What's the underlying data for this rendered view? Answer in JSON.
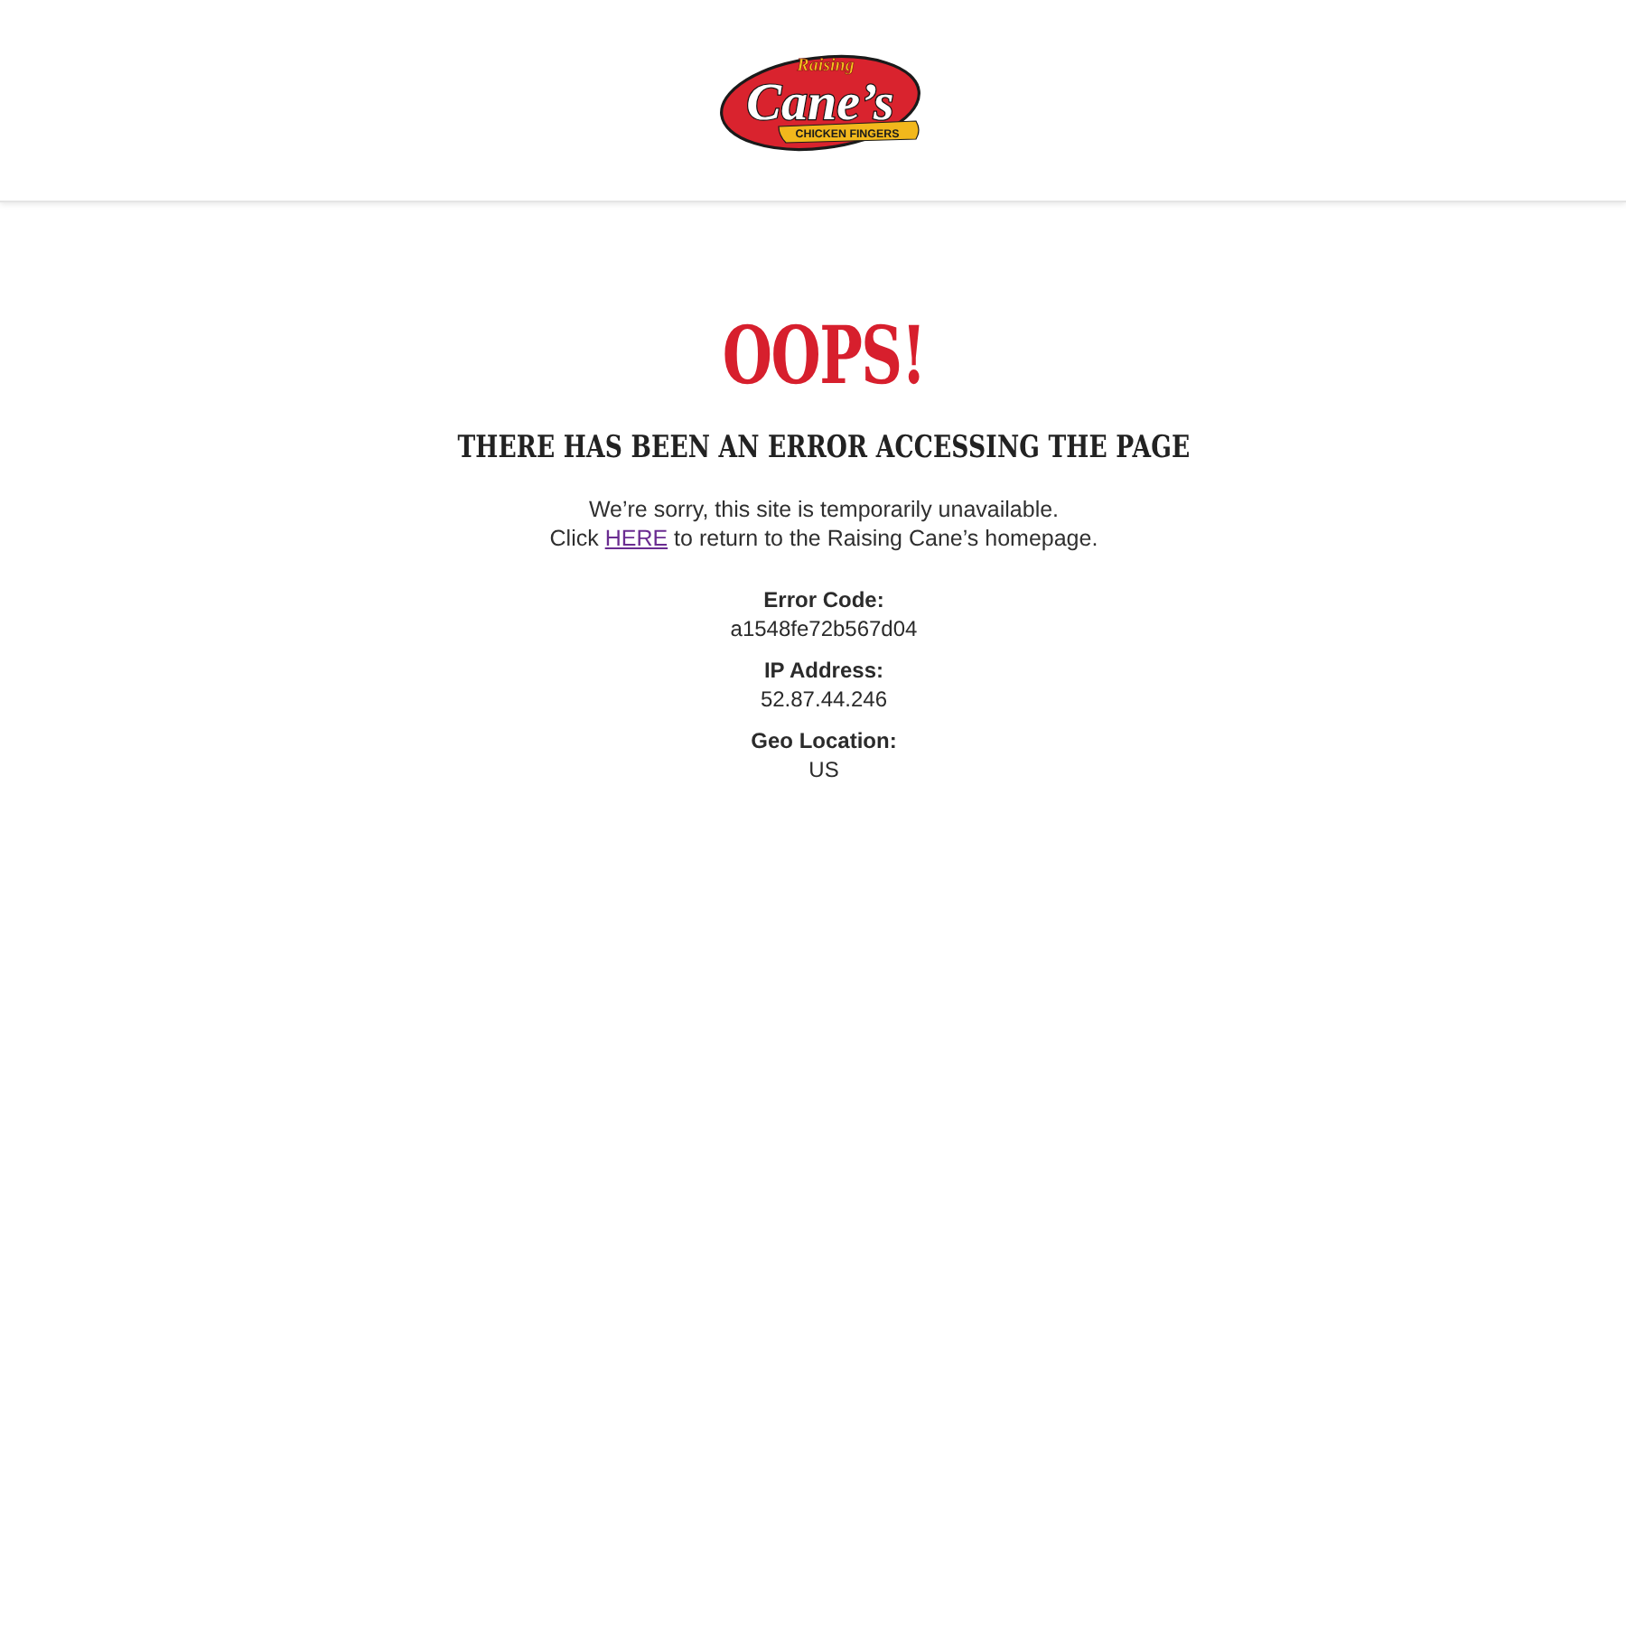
{
  "header": {
    "logo": {
      "script_text": "Raising",
      "wordmark": "Cane’s",
      "tagline": "CHICKEN FINGERS"
    }
  },
  "error": {
    "title": "OOPS!",
    "subtitle": "THERE HAS BEEN AN ERROR ACCESSING THE PAGE",
    "message": {
      "line_1": "We’re sorry, this site is temporarily unavailable.",
      "before_link": "Click",
      "link": "HERE",
      "after_link": "to return to the Raising Cane’s homepage."
    },
    "details": [
      {
        "label": "Error Code:",
        "value": "a1548fe72b567d04"
      },
      {
        "label": "IP Address:",
        "value": "52.87.44.246"
      },
      {
        "label": "Geo Location:",
        "value": "US"
      }
    ]
  }
}
